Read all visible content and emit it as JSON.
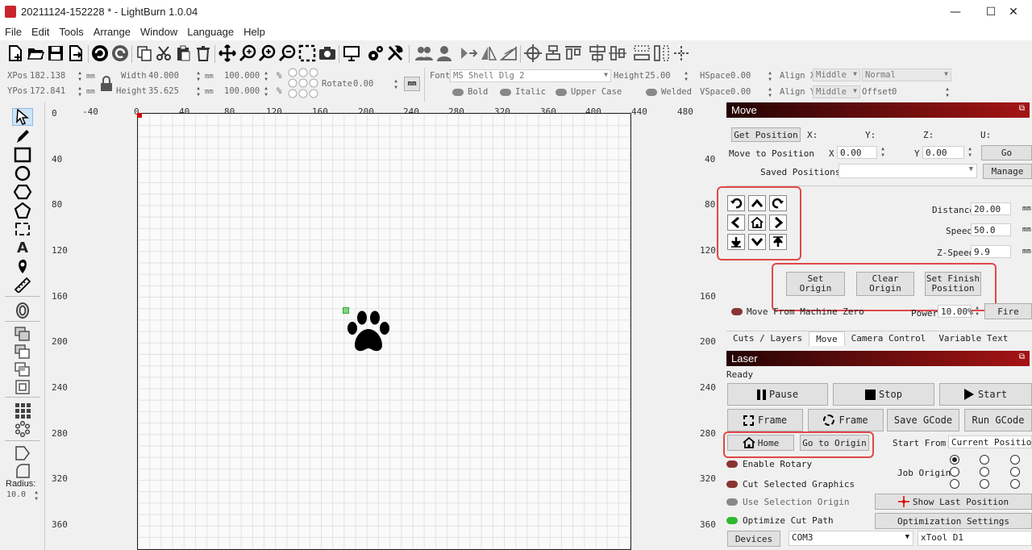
{
  "window": {
    "title": "20211124-152228 * - LightBurn 1.0.04",
    "minimize": "—",
    "maximize": "☐",
    "close": "✕"
  },
  "menu": [
    "File",
    "Edit",
    "Tools",
    "Arrange",
    "Window",
    "Language",
    "Help"
  ],
  "props": {
    "xpos_label": "XPos",
    "xpos": "182.138",
    "ypos_label": "YPos",
    "ypos": "172.841",
    "unit_mm": "mm",
    "width_label": "Width",
    "width": "40.000",
    "height_label": "Height",
    "height": "35.625",
    "scale_w": "100.000",
    "scale_h": "100.000",
    "pct": "%",
    "rotate_label": "Rotate",
    "rotate": "0.00",
    "mm_button": "mm",
    "font_label": "Font",
    "font": "MS Shell Dlg 2",
    "font_height_label": "Height",
    "font_height": "25.00",
    "hspace_label": "HSpace",
    "hspace": "0.00",
    "vspace_label": "VSpace",
    "vspace": "0.00",
    "alignx_label": "Align X",
    "alignx": "Middle",
    "aligny_label": "Align Y",
    "aligny": "Middle",
    "normal": "Normal",
    "offset_label": "Offset",
    "offset": "0",
    "bold": "Bold",
    "italic": "Italic",
    "upper": "Upper Case",
    "welded": "Welded"
  },
  "ruler_top": [
    "-40",
    "0",
    "40",
    "80",
    "120",
    "160",
    "200",
    "240",
    "280",
    "320",
    "360",
    "400",
    "440",
    "480"
  ],
  "ruler_left": [
    "0",
    "40",
    "80",
    "120",
    "160",
    "200",
    "240",
    "280",
    "320",
    "360"
  ],
  "ruler_right": [
    "40",
    "80",
    "120",
    "160",
    "200",
    "240",
    "280",
    "320",
    "360"
  ],
  "lefttools": {
    "radius_label": "Radius:",
    "radius": "10.0"
  },
  "move": {
    "header": "Move",
    "get_position": "Get Position",
    "x_label": "X:",
    "y_label": "Y:",
    "z_label": "Z:",
    "u_label": "U:",
    "move_to_position": "Move to Position",
    "x": "X",
    "x_val": "0.00",
    "y": "Y",
    "y_val": "0.00",
    "go": "Go",
    "saved_positions": "Saved Positions:",
    "manage": "Manage",
    "distance_label": "Distance",
    "distance": "20.00",
    "speed_label": "Speed",
    "speed": "50.0",
    "zspeed_label": "Z-Speed",
    "zspeed": "9.9",
    "unit": "mm",
    "set_origin": "Set Origin",
    "clear_origin": "Clear Origin",
    "set_finish": "Set Finish Position",
    "move_from_zero": "Move From Machine Zero",
    "power_label": "Power",
    "power": "10.00%",
    "fire": "Fire"
  },
  "tabs": [
    "Cuts / Layers",
    "Move",
    "Camera Control",
    "Variable Text"
  ],
  "laser": {
    "header": "Laser",
    "status": "Ready",
    "pause": "Pause",
    "stop": "Stop",
    "start": "Start",
    "frame1": "Frame",
    "frame2": "Frame",
    "save_gcode": "Save GCode",
    "run_gcode": "Run GCode",
    "home": "Home",
    "go_to_origin": "Go to Origin",
    "start_from_label": "Start From:",
    "start_from": "Current Position",
    "enable_rotary": "Enable Rotary",
    "job_origin": "Job Origin",
    "cut_selected": "Cut Selected Graphics",
    "use_selection": "Use Selection Origin",
    "show_last": "Show Last Position",
    "optimize": "Optimize Cut Path",
    "opt_settings": "Optimization Settings",
    "devices": "Devices",
    "port": "COM3",
    "device": "xTool D1"
  },
  "colors": {
    "accent_red": "#e04848",
    "header_dark": "#220303",
    "toggle_green": "#2eb82e"
  }
}
